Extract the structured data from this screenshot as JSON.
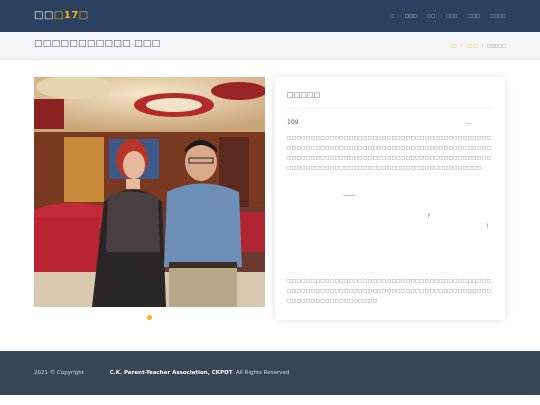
{
  "header": {
    "brand_prefix": "□□",
    "brand_mid": "□",
    "brand_num": "17",
    "brand_suffix": "□",
    "nav": [
      "□",
      "□□□",
      "□□",
      "□□□",
      "□□□",
      "□□□□"
    ]
  },
  "titlebar": {
    "title": "□□□□□□□□□□□ □□□",
    "breadcrumb": [
      "□□",
      "□□□",
      "□□□□□"
    ]
  },
  "article": {
    "heading": "□□□□□",
    "meta_left": "109",
    "meta_right": "...",
    "para1": "□□□□□□□□□□□□□□□□□□□□□□□□□□□□□□□□□□□□□□□□□□□□□□□□□□□□□□□□□□□□□□□□□□□□□□□□□□□□□□□□□□□□□□□□□□□□□□□□□□□□□□□□□□□□□□□□□□□□□□□□□□□□□□□□□□□□□□□□□□□□□□□□□□□□□□□□□□□□□□□□□□□□□□□□□□",
    "dash": "——",
    "question": "?",
    "exclaim": "!",
    "para2": "□□□□□□□□□□□□□□□□□□□□□□□□□□□□□□□□□□□□□□□□□□□□□□□□□□□□□□□□□□□□□□□□□□□□□□□□□□□□□□□□□□□□□□□□□□□□□□□□□□□□□□□□□"
  },
  "photo": {
    "description_icon": "photo-image"
  },
  "footer": {
    "copyright": "2021 © Copyright",
    "org": "C.K. Parent-Teacher Association, CKPOT",
    "rights": ". All Rights Reserved"
  },
  "colors": {
    "navbar": "#2d4160",
    "accent": "#f6b51b",
    "footer": "#3a4658"
  }
}
